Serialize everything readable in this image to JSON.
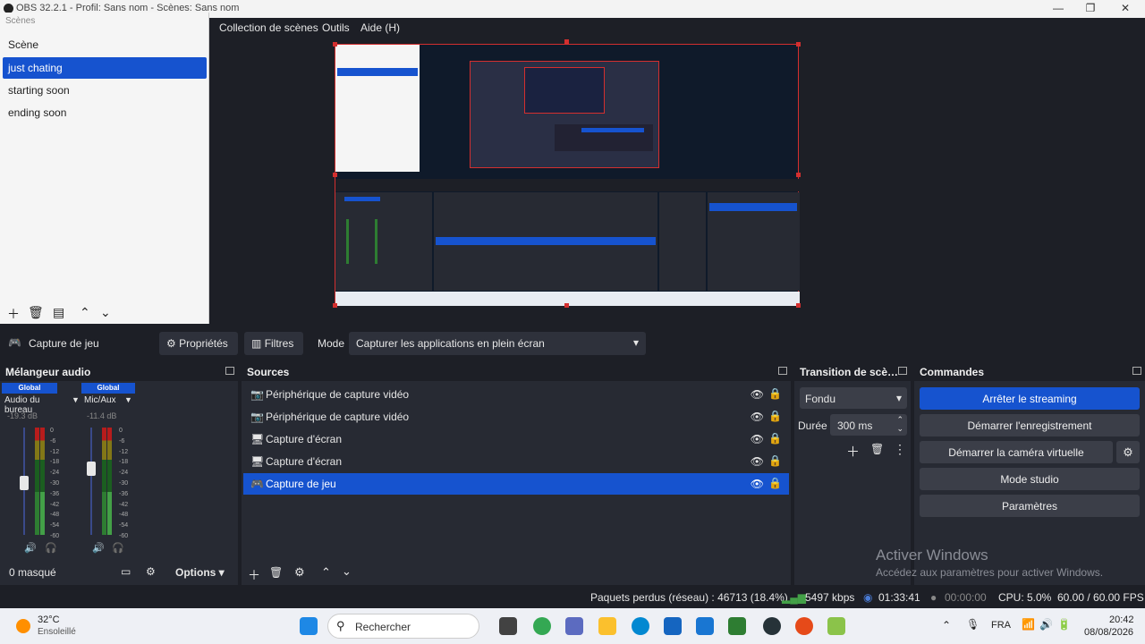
{
  "window": {
    "title": "OBS 32.2.1 - Profil: Sans nom - Scènes: Sans nom",
    "minimize": "—",
    "maximize": "❐",
    "close": "✕"
  },
  "menu": [
    "Collection de scènes",
    "Outils",
    "Aide (H)"
  ],
  "scenes": {
    "header": "Scènes",
    "items": [
      "Scène",
      "just chating",
      "starting soon",
      "ending soon"
    ],
    "selected_index": 1
  },
  "source_toolbar": {
    "current_source": "Capture de jeu",
    "properties_label": "Propriétés",
    "filters_label": "Filtres",
    "mode_label": "Mode",
    "mode_value": "Capturer les applications en plein écran"
  },
  "mixer": {
    "title": "Mélangeur audio",
    "strips": [
      {
        "badge": "Global",
        "name": "Audio du bureau",
        "db": "-19.3 dB",
        "level": 0.55
      },
      {
        "badge": "Global",
        "name": "Mic/Aux",
        "db": "-11.4 dB",
        "level": 0.7
      }
    ],
    "scale": [
      "0",
      "-6",
      "-12",
      "-18",
      "-24",
      "-30",
      "-36",
      "-42",
      "-48",
      "-54",
      "-60"
    ],
    "hidden_count": "0 masqué",
    "options_label": "Options"
  },
  "sources": {
    "title": "Sources",
    "items": [
      {
        "label": "Périphérique de capture vidéo",
        "icon": "camera-icon",
        "selected": false
      },
      {
        "label": "Périphérique de capture vidéo",
        "icon": "camera-icon",
        "selected": false
      },
      {
        "label": "Capture d'écran",
        "icon": "monitor-icon",
        "selected": false
      },
      {
        "label": "Capture d'écran",
        "icon": "monitor-icon",
        "selected": false
      },
      {
        "label": "Capture de jeu",
        "icon": "gamepad-icon",
        "selected": true
      }
    ]
  },
  "transition": {
    "title": "Transition de scè…",
    "type": "Fondu",
    "duration_label": "Durée",
    "duration_value": "300 ms"
  },
  "commands": {
    "title": "Commandes",
    "stop_streaming": "Arrêter le streaming",
    "start_recording": "Démarrer l'enregistrement",
    "start_virtual_cam": "Démarrer la caméra virtuelle",
    "studio_mode": "Mode studio",
    "settings": "Paramètres"
  },
  "watermark": {
    "line1": "Activer Windows",
    "line2": "Accédez aux paramètres pour activer Windows."
  },
  "status": {
    "dropped": "Paquets perdus (réseau) : 46713 (18.4%)",
    "bitrate": "5497 kbps",
    "stream_time": "01:33:41",
    "rec_time": "00:00:00",
    "cpu": "CPU: 5.0%",
    "fps": "60.00 / 60.00 FPS"
  },
  "taskbar": {
    "weather_temp": "32°C",
    "weather_desc": "Ensoleillé",
    "search_placeholder": "Rechercher",
    "lang": "FRA",
    "time": "20:42",
    "date": "08/08/2026"
  }
}
